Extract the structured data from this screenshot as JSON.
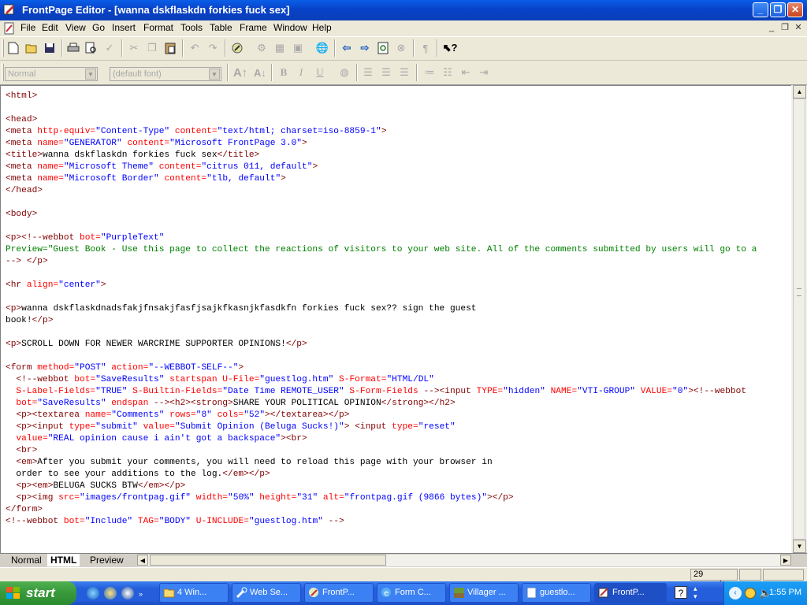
{
  "window": {
    "title": "FrontPage Editor - [wanna dskflaskdn forkies fuck sex]",
    "minimize": "_",
    "restore": "❐",
    "close": "✕"
  },
  "menu": [
    "File",
    "Edit",
    "View",
    "Go",
    "Insert",
    "Format",
    "Tools",
    "Table",
    "Frame",
    "Window",
    "Help"
  ],
  "format_bar": {
    "style_value": "Normal",
    "font_value": "(default font)"
  },
  "editor": {
    "lines": [
      [
        [
          "tg",
          "<html>"
        ]
      ],
      [],
      [
        [
          "tg",
          "<head>"
        ]
      ],
      [
        [
          "tg",
          "<meta "
        ],
        [
          "at",
          "http-equiv="
        ],
        [
          "vl",
          "\"Content-Type\""
        ],
        [
          "at",
          " content="
        ],
        [
          "vl",
          "\"text/html; charset=iso-8859-1\""
        ],
        [
          "tg",
          ">"
        ]
      ],
      [
        [
          "tg",
          "<meta "
        ],
        [
          "at",
          "name="
        ],
        [
          "vl",
          "\"GENERATOR\""
        ],
        [
          "at",
          " content="
        ],
        [
          "vl",
          "\"Microsoft FrontPage 3.0\""
        ],
        [
          "tg",
          ">"
        ]
      ],
      [
        [
          "tg",
          "<title>"
        ],
        [
          "tx",
          "wanna dskflaskdn forkies fuck sex"
        ],
        [
          "tg",
          "</title>"
        ]
      ],
      [
        [
          "tg",
          "<meta "
        ],
        [
          "at",
          "name="
        ],
        [
          "vl",
          "\"Microsoft Theme\""
        ],
        [
          "at",
          " content="
        ],
        [
          "vl",
          "\"citrus 011, default\""
        ],
        [
          "tg",
          ">"
        ]
      ],
      [
        [
          "tg",
          "<meta "
        ],
        [
          "at",
          "name="
        ],
        [
          "vl",
          "\"Microsoft Border\""
        ],
        [
          "at",
          " content="
        ],
        [
          "vl",
          "\"tlb, default\""
        ],
        [
          "tg",
          ">"
        ]
      ],
      [
        [
          "tg",
          "</head>"
        ]
      ],
      [],
      [
        [
          "tg",
          "<body>"
        ]
      ],
      [],
      [
        [
          "tg",
          "<p>"
        ],
        [
          "tg",
          "<!--webbot "
        ],
        [
          "at",
          "bot="
        ],
        [
          "vl",
          "\"PurpleText\""
        ]
      ],
      [
        [
          "cm",
          "Preview=\"Guest Book - Use this page to collect the reactions of visitors to your web site. All of the comments submitted by users will go to a"
        ]
      ],
      [
        [
          "tg",
          "--> </p>"
        ]
      ],
      [],
      [
        [
          "tg",
          "<hr "
        ],
        [
          "at",
          "align="
        ],
        [
          "vl",
          "\"center\""
        ],
        [
          "tg",
          ">"
        ]
      ],
      [],
      [
        [
          "tg",
          "<p>"
        ],
        [
          "tx",
          "wanna dskflaskdnadsfakjfnsakjfasfjsajkfkasnjkfasdkfn forkies fuck sex?? sign the guest"
        ]
      ],
      [
        [
          "tx",
          "book!"
        ],
        [
          "tg",
          "</p>"
        ]
      ],
      [],
      [
        [
          "tg",
          "<p>"
        ],
        [
          "tx",
          "SCROLL DOWN FOR NEWER WARCRIME SUPPORTER OPINIONS!"
        ],
        [
          "tg",
          "</p>"
        ]
      ],
      [],
      [
        [
          "tg",
          "<form "
        ],
        [
          "at",
          "method="
        ],
        [
          "vl",
          "\"POST\""
        ],
        [
          "at",
          " action="
        ],
        [
          "vl",
          "\"--WEBBOT-SELF--\""
        ],
        [
          "tg",
          ">"
        ]
      ],
      [
        [
          "tx",
          "  "
        ],
        [
          "tg",
          "<!--webbot "
        ],
        [
          "at",
          "bot="
        ],
        [
          "vl",
          "\"SaveResults\""
        ],
        [
          "at",
          " startspan U-File="
        ],
        [
          "vl",
          "\"guestlog.htm\""
        ],
        [
          "at",
          " S-Format="
        ],
        [
          "vl",
          "\"HTML/DL\""
        ]
      ],
      [
        [
          "at",
          "  S-Label-Fields="
        ],
        [
          "vl",
          "\"TRUE\""
        ],
        [
          "at",
          " S-Builtin-Fields="
        ],
        [
          "vl",
          "\"Date Time REMOTE_USER\""
        ],
        [
          "at",
          " S-Form-Fields "
        ],
        [
          "tg",
          "--><input "
        ],
        [
          "at",
          "TYPE="
        ],
        [
          "vl",
          "\"hidden\""
        ],
        [
          "at",
          " NAME="
        ],
        [
          "vl",
          "\"VTI-GROUP\""
        ],
        [
          "at",
          " VALUE="
        ],
        [
          "vl",
          "\"0\""
        ],
        [
          "tg",
          "><!--webbot"
        ]
      ],
      [
        [
          "at",
          "  bot="
        ],
        [
          "vl",
          "\"SaveResults\""
        ],
        [
          "at",
          " endspan "
        ],
        [
          "tg",
          "--><h2><strong>"
        ],
        [
          "tx",
          "SHARE YOUR POLITICAL OPINION"
        ],
        [
          "tg",
          "</strong></h2>"
        ]
      ],
      [
        [
          "tx",
          "  "
        ],
        [
          "tg",
          "<p><textarea "
        ],
        [
          "at",
          "name="
        ],
        [
          "vl",
          "\"Comments\""
        ],
        [
          "at",
          " rows="
        ],
        [
          "vl",
          "\"8\""
        ],
        [
          "at",
          " cols="
        ],
        [
          "vl",
          "\"52\""
        ],
        [
          "tg",
          "></textarea></p>"
        ]
      ],
      [
        [
          "tx",
          "  "
        ],
        [
          "tg",
          "<p><input "
        ],
        [
          "at",
          "type="
        ],
        [
          "vl",
          "\"submit\""
        ],
        [
          "at",
          " value="
        ],
        [
          "vl",
          "\"Submit Opinion (Beluga Sucks!)\""
        ],
        [
          "tg",
          ">"
        ],
        [
          "tx",
          " "
        ],
        [
          "tg",
          "<input "
        ],
        [
          "at",
          "type="
        ],
        [
          "vl",
          "\"reset\""
        ]
      ],
      [
        [
          "at",
          "  value="
        ],
        [
          "vl",
          "\"REAL opinion cause i ain't got a backspace\""
        ],
        [
          "tg",
          "><br>"
        ]
      ],
      [
        [
          "tx",
          "  "
        ],
        [
          "tg",
          "<br>"
        ]
      ],
      [
        [
          "tx",
          "  "
        ],
        [
          "tg",
          "<em>"
        ],
        [
          "tx",
          "After you submit your comments, you will need to reload this page with your browser in"
        ]
      ],
      [
        [
          "tx",
          "  order to see your additions to the log."
        ],
        [
          "tg",
          "</em></p>"
        ]
      ],
      [
        [
          "tx",
          "  "
        ],
        [
          "tg",
          "<p><em>"
        ],
        [
          "tx",
          "BELUGA SUCKS BTW"
        ],
        [
          "tg",
          "</em></p>"
        ]
      ],
      [
        [
          "tx",
          "  "
        ],
        [
          "tg",
          "<p><img "
        ],
        [
          "at",
          "src="
        ],
        [
          "vl",
          "\"images/frontpag.gif\""
        ],
        [
          "at",
          " width="
        ],
        [
          "vl",
          "\"50%\""
        ],
        [
          "at",
          " height="
        ],
        [
          "vl",
          "\"31\""
        ],
        [
          "at",
          " alt="
        ],
        [
          "vl",
          "\"frontpag.gif (9866 bytes)\""
        ],
        [
          "tg",
          "></p>"
        ]
      ],
      [
        [
          "tg",
          "</form>"
        ]
      ],
      [
        [
          "tg",
          "<!--webbot "
        ],
        [
          "at",
          "bot="
        ],
        [
          "vl",
          "\"Include\""
        ],
        [
          "at",
          " TAG="
        ],
        [
          "vl",
          "\"BODY\""
        ],
        [
          "at",
          " U-INCLUDE="
        ],
        [
          "vl",
          "\"guestlog.htm\""
        ],
        [
          "tg",
          " -->"
        ]
      ]
    ]
  },
  "tabs": [
    {
      "label": "Normal",
      "active": false
    },
    {
      "label": "HTML",
      "active": true
    },
    {
      "label": "Preview",
      "active": false
    }
  ],
  "status": {
    "time": "29 seconds"
  },
  "taskbar": {
    "start_label": "start",
    "tasks": [
      {
        "label": "4 Win...",
        "icon": "folder-icon"
      },
      {
        "label": "Web Se...",
        "icon": "tool-icon"
      },
      {
        "label": "FrontP...",
        "icon": "frontpage-icon"
      },
      {
        "label": "Form C...",
        "icon": "ie-icon"
      },
      {
        "label": "Villager ...",
        "icon": "minecraft-icon"
      },
      {
        "label": "guestlo...",
        "icon": "document-icon"
      },
      {
        "label": "FrontP...",
        "icon": "frontpage-icon",
        "active": true
      }
    ],
    "clock": "1:55 PM"
  },
  "colors": {
    "tag": "#800000",
    "attr": "#ff0000",
    "value": "#0000ff",
    "comment": "#008000",
    "accent": "#0842c8"
  }
}
